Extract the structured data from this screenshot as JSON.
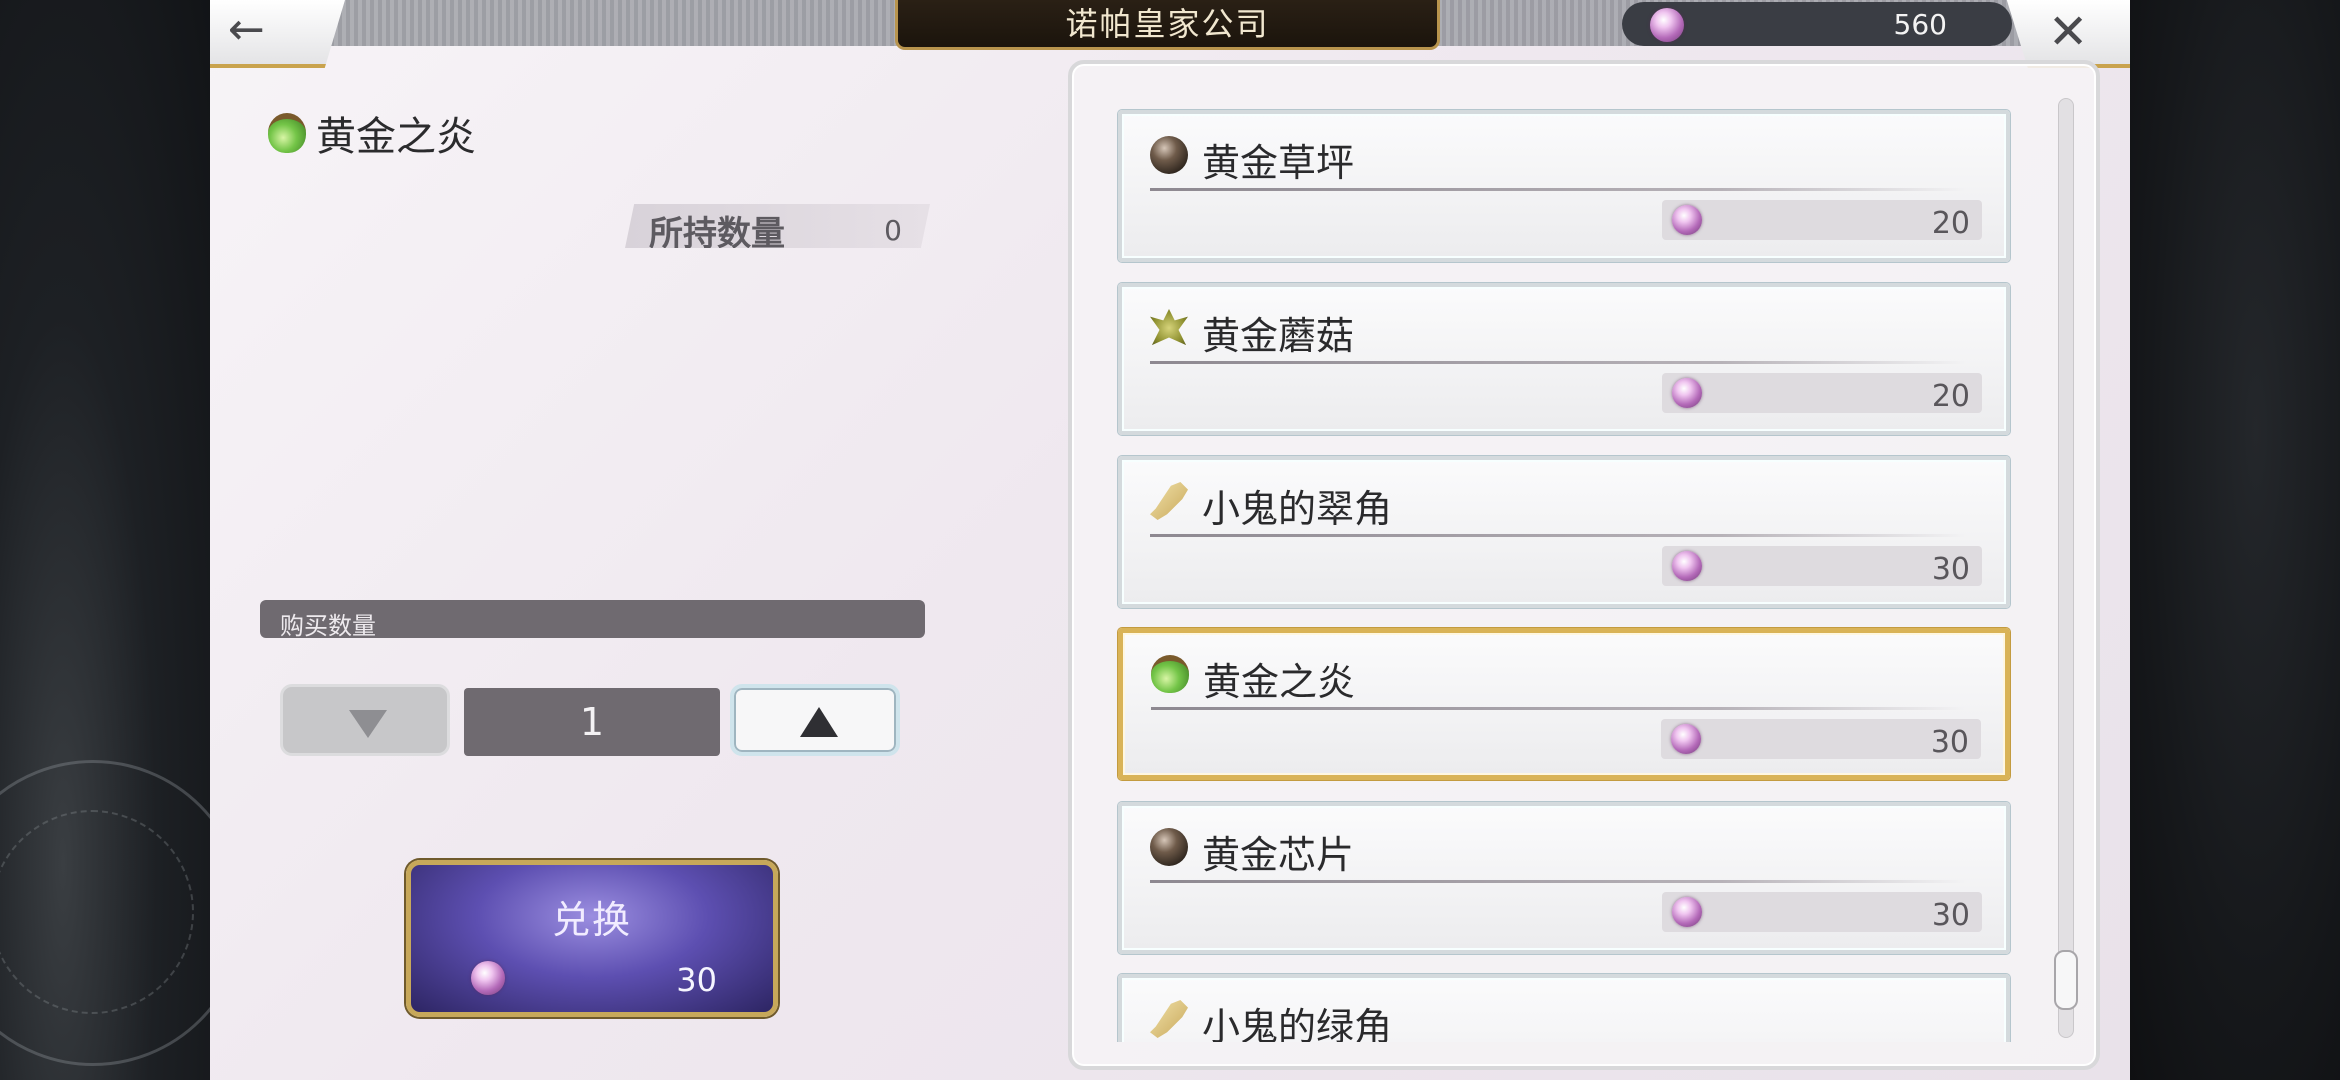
{
  "header": {
    "title": "诺帕皇家公司",
    "currency_amount": "560",
    "back_icon": "left-arrow-icon",
    "close_icon": "close-icon",
    "currency_icon": "purple-gem-icon"
  },
  "detail": {
    "item_name": "黄金之炎",
    "item_icon": "green-potion-icon",
    "owned_label": "所持数量",
    "owned_value": "0",
    "quantity_label": "购买数量",
    "quantity_value": "1",
    "exchange_label": "兑换",
    "exchange_cost": "30"
  },
  "shop_items": [
    {
      "name": "黄金草坪",
      "icon": "dark-orb-icon",
      "price": "20"
    },
    {
      "name": "黄金蘑菇",
      "icon": "leaf-icon",
      "price": "20"
    },
    {
      "name": "小鬼的翠角",
      "icon": "horn-icon",
      "price": "30"
    },
    {
      "name": "黄金之炎",
      "icon": "green-potion-icon",
      "price": "30",
      "selected": true
    },
    {
      "name": "黄金芯片",
      "icon": "dark-orb-icon",
      "price": "30"
    },
    {
      "name": "小鬼的绿角",
      "icon": "horn-icon",
      "price": ""
    }
  ],
  "colors": {
    "accent_gold": "#d9b357",
    "exchange_purple": "#5d4fb1",
    "panel_bg": "#f3eef3"
  }
}
